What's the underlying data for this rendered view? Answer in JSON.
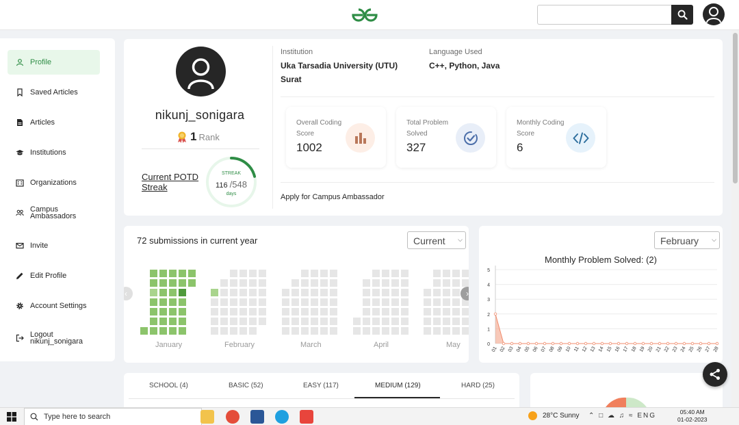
{
  "search": {
    "placeholder": ""
  },
  "sidebar": {
    "items": [
      {
        "label": "Profile",
        "icon": "user-icon",
        "active": true
      },
      {
        "label": "Saved Articles",
        "icon": "bookmark-icon"
      },
      {
        "label": "Articles",
        "icon": "document-icon"
      },
      {
        "label": "Institutions",
        "icon": "graduation-cap-icon"
      },
      {
        "label": "Organizations",
        "icon": "building-icon"
      },
      {
        "label": "Campus Ambassadors",
        "icon": "people-icon"
      },
      {
        "label": "Invite",
        "icon": "mail-icon"
      },
      {
        "label": "Edit Profile",
        "icon": "pencil-icon"
      },
      {
        "label": "Account Settings",
        "icon": "gear-icon"
      },
      {
        "label": "Logout nikunj_sonigara",
        "icon": "logout-icon"
      }
    ]
  },
  "profile": {
    "username": "nikunj_sonigara",
    "rank_number": "1",
    "rank_label": "Rank",
    "potd_label": "Current POTD Streak",
    "streak_label": "STREAK",
    "streak_current": "116",
    "streak_total": "/548",
    "streak_fraction": 0.212,
    "streak_unit": "days",
    "institution_label": "Institution",
    "institution_value": "Uka Tarsadia University (UTU) Surat",
    "language_label": "Language Used",
    "language_value": "C++, Python, Java",
    "campus_link": "Apply for Campus Ambassador"
  },
  "stats": [
    {
      "title": "Overall Coding Score",
      "value": "1002",
      "icon": "bar-chart-icon",
      "bg": "#fdeee6",
      "fg": "#b9775a"
    },
    {
      "title": "Total Problem Solved",
      "value": "327",
      "icon": "check-badge-icon",
      "bg": "#e8eef8",
      "fg": "#4b6ea9"
    },
    {
      "title": "Monthly Coding Score",
      "value": "6",
      "icon": "code-icon",
      "bg": "#e6f2fb",
      "fg": "#2e6f9e"
    }
  ],
  "submissions": {
    "title": "72 submissions in current year",
    "year_select": "Current",
    "months": [
      "January",
      "February",
      "March",
      "April",
      "May"
    ]
  },
  "monthly_chart": {
    "month_select": "February",
    "title": "Monthly Problem Solved: (2)"
  },
  "chart_data": {
    "type": "area",
    "title": "Monthly Problem Solved: (2)",
    "x": [
      "01",
      "02",
      "03",
      "04",
      "05",
      "06",
      "07",
      "08",
      "09",
      "10",
      "11",
      "12",
      "13",
      "14",
      "15",
      "16",
      "17",
      "18",
      "19",
      "20",
      "21",
      "22",
      "23",
      "24",
      "25",
      "26",
      "27",
      "28"
    ],
    "values": [
      2,
      0,
      0,
      0,
      0,
      0,
      0,
      0,
      0,
      0,
      0,
      0,
      0,
      0,
      0,
      0,
      0,
      0,
      0,
      0,
      0,
      0,
      0,
      0,
      0,
      0,
      0,
      0
    ],
    "yticks": [
      "0",
      "1",
      "2",
      "3",
      "4",
      "5"
    ],
    "ylim": [
      0,
      5
    ],
    "color": "#f4a58a",
    "grid": true
  },
  "tabs": [
    {
      "label": "SCHOOL (4)"
    },
    {
      "label": "BASIC (52)"
    },
    {
      "label": "EASY (117)"
    },
    {
      "label": "MEDIUM (129)",
      "active": true
    },
    {
      "label": "HARD (25)"
    }
  ],
  "taskbar": {
    "search_text": "Type here to search",
    "weather": "28°C  Sunny",
    "lang": "ENG",
    "time": "05:40 AM",
    "date": "01-02-2023"
  },
  "colors": {
    "brand": "#2f8d46",
    "dark": "#262626"
  }
}
